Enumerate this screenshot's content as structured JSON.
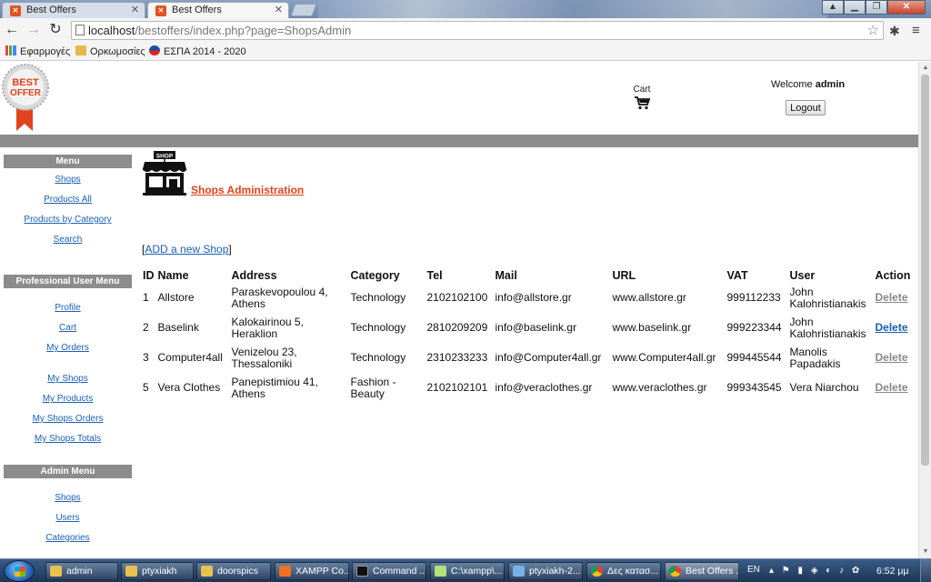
{
  "browser": {
    "tabs": [
      {
        "title": "Best Offers",
        "active": false
      },
      {
        "title": "Best Offers",
        "active": true
      }
    ],
    "url_host": "localhost",
    "url_path": "/bestoffers/index.php?page=ShopsAdmin",
    "bookmarks": [
      {
        "label": "Εφαρμογές",
        "icon": "apps-icon"
      },
      {
        "label": "Ορκωμοσίες",
        "icon": "folder-icon"
      },
      {
        "label": "ΕΣΠΑ 2014 - 2020",
        "icon": "espa-icon"
      }
    ]
  },
  "site": {
    "logo_text_1": "BEST",
    "logo_text_2": "OFFER",
    "cart_label": "Cart",
    "welcome_prefix": "Welcome",
    "username": "admin",
    "logout_label": "Logout"
  },
  "sidebar": {
    "menu_title": "Menu",
    "menu_items": [
      "Shops",
      "Products All",
      "Products by Category",
      "Search"
    ],
    "pro_title": "Professional User Menu",
    "pro_items": [
      "Profile",
      "Cart",
      "My Orders"
    ],
    "pro_items_2": [
      "My Shops",
      "My Products",
      "My Shops Orders",
      "My Shops Totals"
    ],
    "admin_title": "Admin Menu",
    "admin_items": [
      "Shops",
      "Users",
      "Categories"
    ]
  },
  "main": {
    "shop_sign": "SHOP",
    "title": "Shops Administration",
    "add_bracket_open": "[",
    "add_link": "ADD a new Shop",
    "add_bracket_close": "]",
    "columns": [
      "ID",
      "Name",
      "Address",
      "Category",
      "Tel",
      "Mail",
      "URL",
      "VAT",
      "User",
      "Action"
    ],
    "rows": [
      {
        "id": "1",
        "name": "Allstore",
        "address": "Paraskevopoulou 4, Athens",
        "category": "Technology",
        "tel": "2102102100",
        "mail": "info@allstore.gr",
        "url": "www.allstore.gr",
        "vat": "999112233",
        "user": "John Kalohristianakis",
        "action": "Delete",
        "highlighted": false
      },
      {
        "id": "2",
        "name": "Baselink",
        "address": "Kalokairinou 5, Heraklion",
        "category": "Technology",
        "tel": "2810209209",
        "mail": "info@baselink.gr",
        "url": "www.baselink.gr",
        "vat": "999223344",
        "user": "John Kalohristianakis",
        "action": "Delete",
        "highlighted": true
      },
      {
        "id": "3",
        "name": "Computer4all",
        "address": "Venizelou 23, Thessaloniki",
        "category": "Technology",
        "tel": "2310233233",
        "mail": "info@Computer4all.gr",
        "url": "www.Computer4all.gr",
        "vat": "999445544",
        "user": "Manolis Papadakis",
        "action": "Delete",
        "highlighted": false
      },
      {
        "id": "5",
        "name": "Vera Clothes",
        "address": "Panepistimiou 41, Athens",
        "category": "Fashion - Beauty",
        "tel": "2102102101",
        "mail": "info@veraclothes.gr",
        "url": "www.veraclothes.gr",
        "vat": "999343545",
        "user": "Vera Niarchou",
        "action": "Delete",
        "highlighted": false
      }
    ]
  },
  "taskbar": {
    "items": [
      {
        "label": "admin",
        "icon": "folder-icon"
      },
      {
        "label": "ptyxiakh",
        "icon": "folder-icon"
      },
      {
        "label": "doorspics",
        "icon": "folder-icon"
      },
      {
        "label": "XAMPP Co...",
        "icon": "xampp-icon"
      },
      {
        "label": "Command ...",
        "icon": "cmd-icon"
      },
      {
        "label": "C:\\xampp\\...",
        "icon": "notepad-icon"
      },
      {
        "label": "ptyxiakh-2...",
        "icon": "rdp-icon"
      },
      {
        "label": "Δες κατασ...",
        "icon": "chrome-icon"
      },
      {
        "label": "Best Offers ...",
        "icon": "chrome-icon"
      }
    ],
    "language": "EN",
    "clock": "6:52 μμ"
  },
  "colors": {
    "accent_orange": "#e0431d",
    "link_blue": "#1a5fb4",
    "band_grey": "#8c8c8c"
  }
}
